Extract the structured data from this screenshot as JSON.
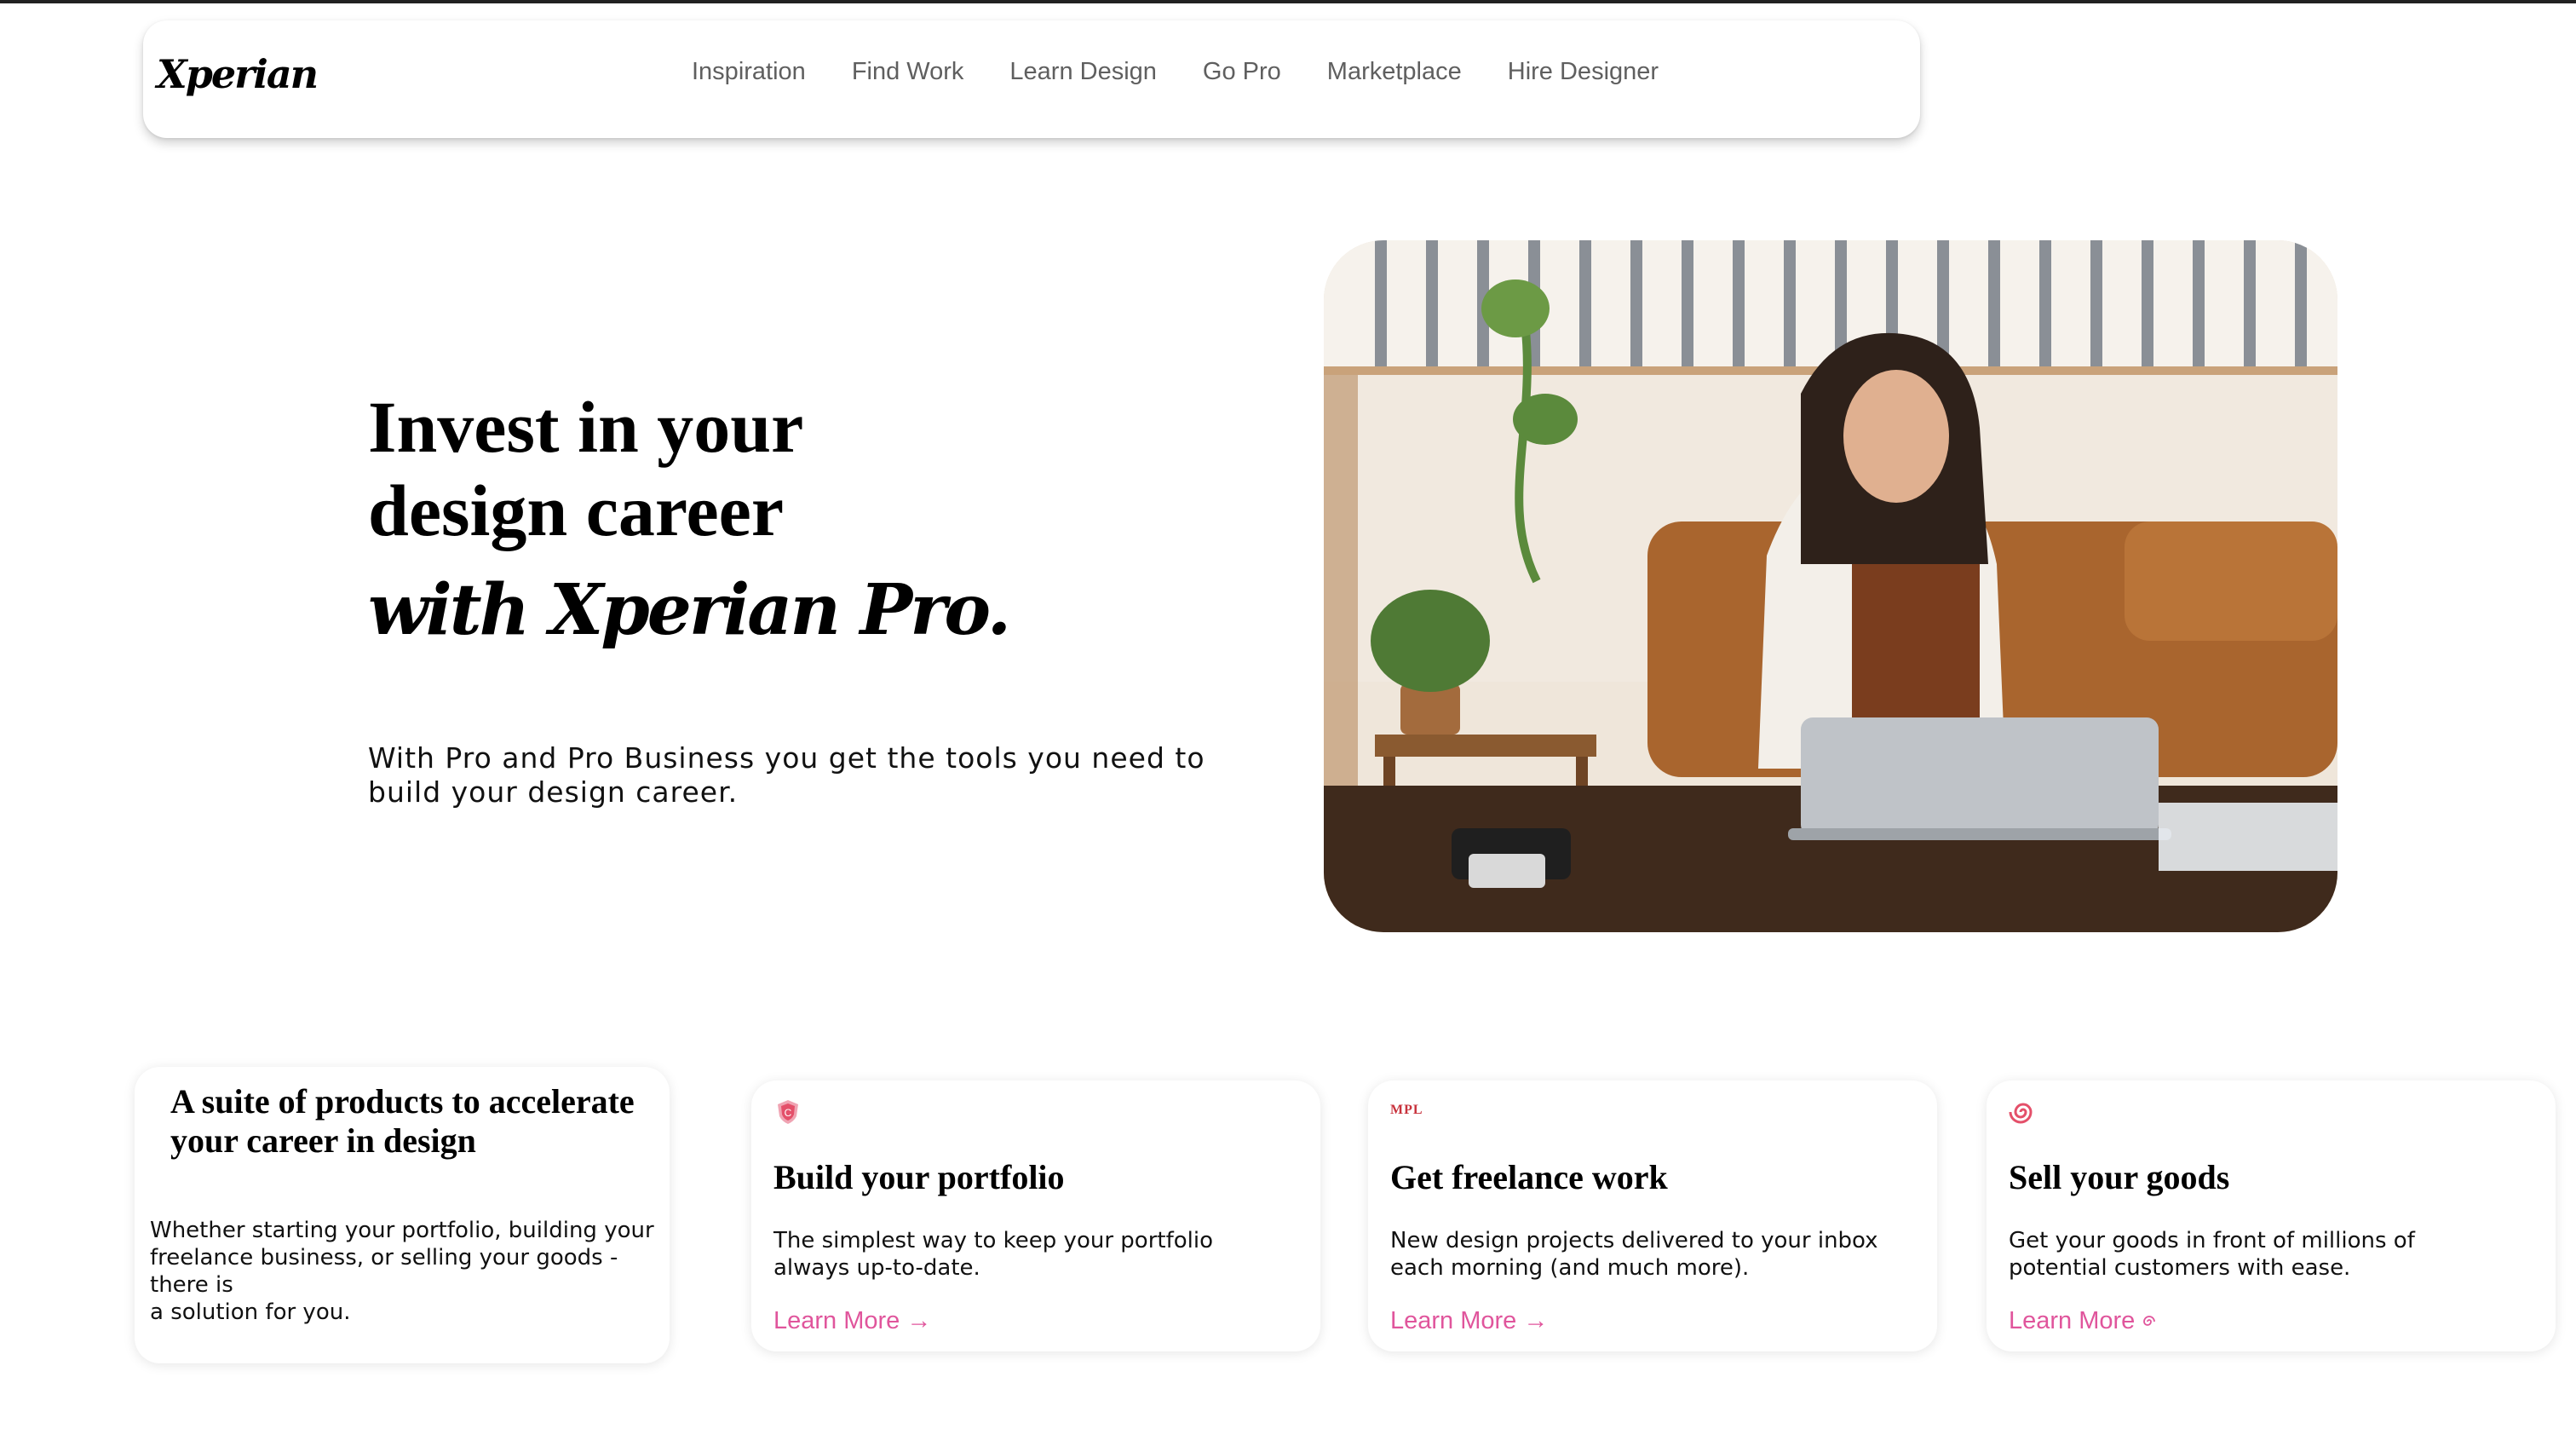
{
  "brand": {
    "logo": "Xperian",
    "accent": "#e0559c"
  },
  "nav": {
    "items": [
      {
        "label": "Inspiration"
      },
      {
        "label": "Find Work"
      },
      {
        "label": "Learn Design"
      },
      {
        "label": "Go Pro"
      },
      {
        "label": "Marketplace"
      },
      {
        "label": "Hire Designer"
      }
    ]
  },
  "hero": {
    "title_line1": "Invest in your",
    "title_line2": "design career",
    "script": "with Xperian Pro.",
    "subtitle": "With Pro and Pro Business you get the tools you need to build your design career."
  },
  "intro_card": {
    "title": "A suite of products to accelerate your career in design",
    "text": "Whether starting your portfolio, building your freelance business, or selling your goods - there is",
    "text2": "a solution for you."
  },
  "cards": [
    {
      "icon": "shield-icon",
      "title": "Build your portfolio",
      "text": "The simplest way to keep your portfolio always up-to-date.",
      "link": "Learn More →"
    },
    {
      "icon": "mpl-badge",
      "badge": "MPL",
      "title": "Get freelance work",
      "text": "New design projects delivered to your inbox each morning (and much more).",
      "link": "Learn More →"
    },
    {
      "icon": "spiral-icon",
      "title": "Sell your goods",
      "text": "Get your goods in front of millions of potential customers with ease.",
      "link": "Learn More"
    }
  ]
}
